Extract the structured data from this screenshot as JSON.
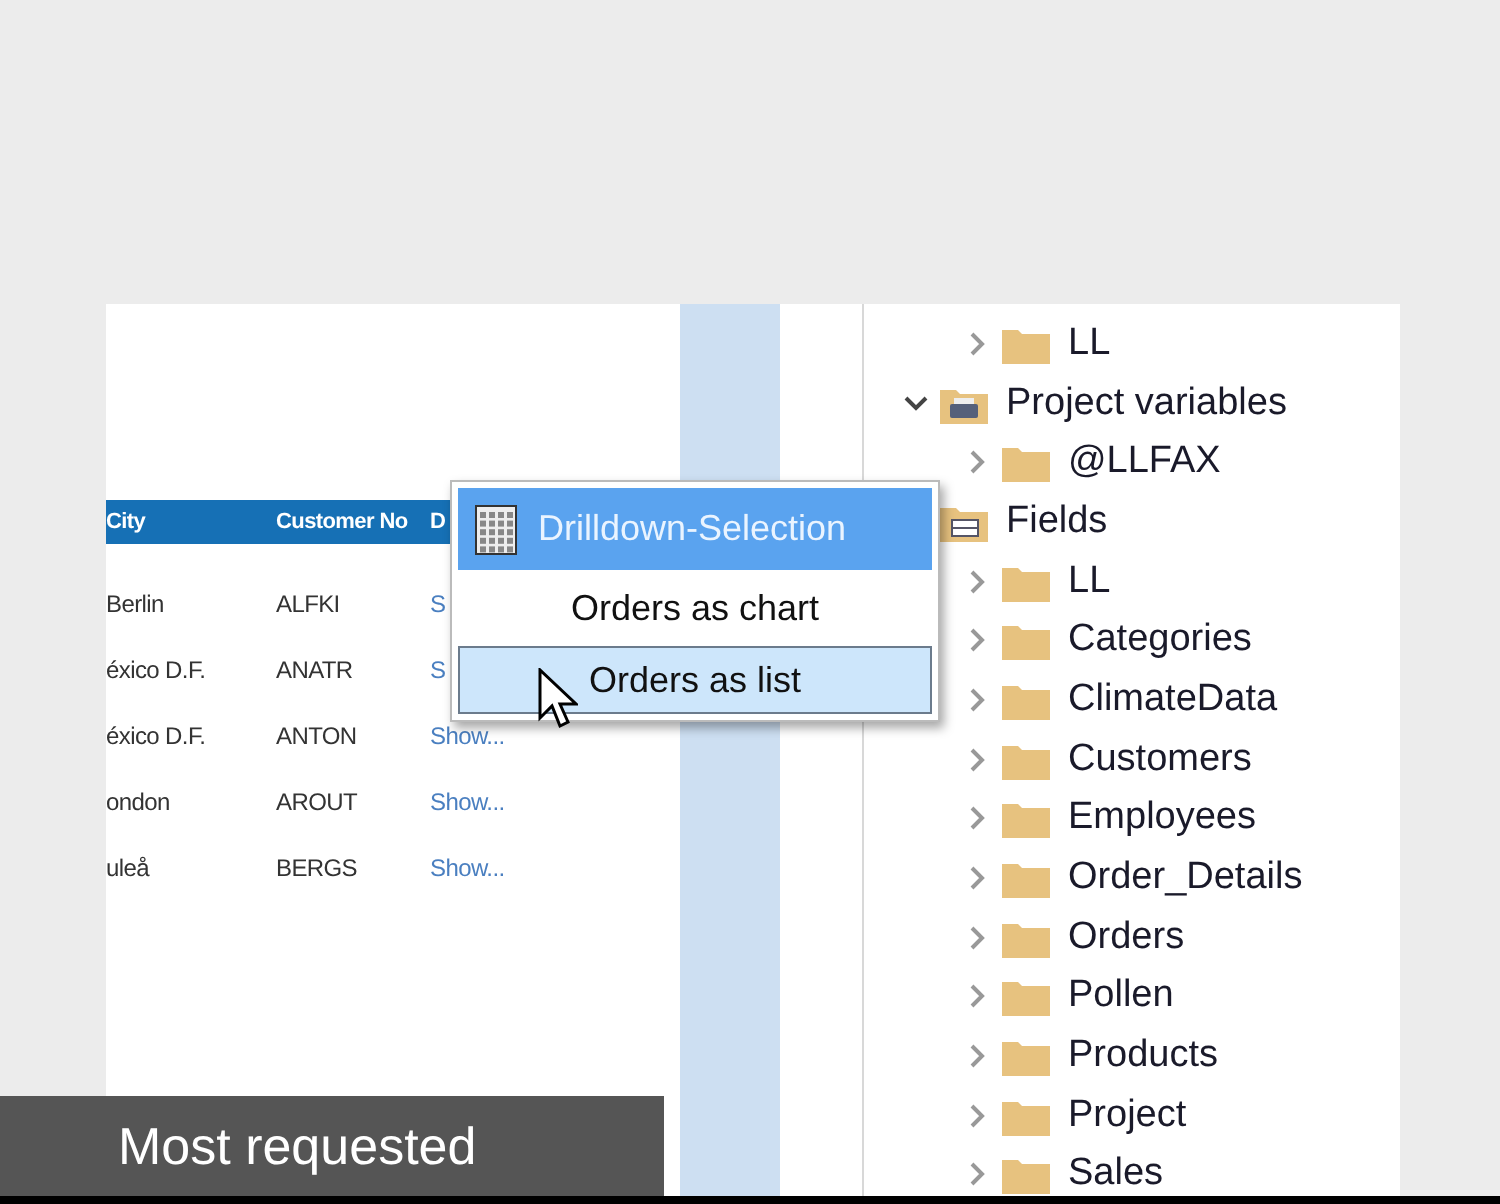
{
  "table": {
    "columns": [
      "City",
      "Customer No",
      "D"
    ],
    "rows": [
      {
        "cells": [
          "Berlin",
          "ALFKI",
          "S"
        ]
      },
      {
        "cells": [
          "éxico D.F.",
          "ANATR",
          "S"
        ]
      },
      {
        "cells": [
          "éxico D.F.",
          "ANTON",
          "Show..."
        ]
      },
      {
        "cells": [
          "ondon",
          "AROUT",
          "Show..."
        ]
      },
      {
        "cells": [
          "uleå",
          "BERGS",
          "Show..."
        ]
      }
    ]
  },
  "popup_menu": {
    "title": "Drilldown-Selection",
    "items": [
      {
        "label": "Orders as chart",
        "selected": false
      },
      {
        "label": "Orders as list",
        "selected": true
      }
    ]
  },
  "tree": {
    "continued_children": [
      {
        "label": "LL",
        "kind": "folder",
        "expanded": false
      }
    ],
    "items": [
      {
        "label": "Project variables",
        "kind": "printer",
        "expanded": true,
        "children": [
          {
            "label": "@LLFAX",
            "kind": "folder",
            "expanded": false
          }
        ]
      },
      {
        "label": "Fields",
        "kind": "table",
        "children": [
          {
            "label": "LL",
            "kind": "folder",
            "expanded": false
          },
          {
            "label": "Categories",
            "kind": "folder",
            "expanded": false
          },
          {
            "label": "ClimateData",
            "kind": "folder",
            "expanded": false
          },
          {
            "label": "Customers",
            "kind": "folder",
            "expanded": false
          },
          {
            "label": "Employees",
            "kind": "folder",
            "expanded": false
          },
          {
            "label": "Order_Details",
            "kind": "folder",
            "expanded": false
          },
          {
            "label": "Orders",
            "kind": "folder",
            "expanded": false
          },
          {
            "label": "Pollen",
            "kind": "folder",
            "expanded": false
          },
          {
            "label": "Products",
            "kind": "folder",
            "expanded": false
          },
          {
            "label": "Project",
            "kind": "folder",
            "expanded": false
          },
          {
            "label": "Sales",
            "kind": "folder",
            "expanded": false
          }
        ]
      }
    ]
  },
  "caption": "Most requested"
}
